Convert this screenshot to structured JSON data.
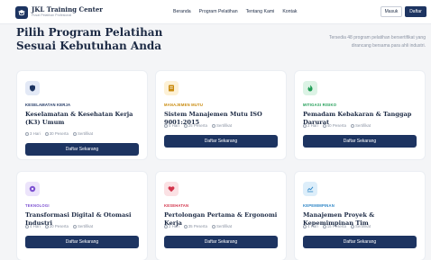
{
  "brand": {
    "title": "JKL Training Center",
    "subtitle": "Pusat Pelatihan Profesional"
  },
  "nav": {
    "links": [
      "Beranda",
      "Program Pelatihan",
      "Tentang Kami",
      "Kontak"
    ],
    "login": "Masuk",
    "register": "Daftar"
  },
  "hero": {
    "title_line1": "Pilih Program Pelatihan",
    "title_line2": "Sesuai Kebutuhan Anda",
    "desc_line1": "Tersedia 48 program pelatihan bersertifikat yang",
    "desc_line2": "dirancang bersama para ahli industri."
  },
  "colors": {
    "primary": "#1d3461",
    "background": "#f4f5f7"
  },
  "cards": [
    {
      "icon": "shield-icon",
      "category": "KESELAMATAN KERJA",
      "cat_color": "#1d3461",
      "icon_bg": "#e3e9f6",
      "title": "Keselamatan & Kesehatan Kerja (K3) Umum",
      "days": "3 Hari",
      "participants": "30 Peserta",
      "cert": "Sertifikat",
      "button": "Daftar Sekarang"
    },
    {
      "icon": "document-icon",
      "category": "MANAJEMEN MUTU",
      "cat_color": "#c98a0c",
      "icon_bg": "#fdf1d6",
      "title": "Sistem Manajemen Mutu ISO 9001:2015",
      "days": "5 Hari",
      "participants": "25 Peserta",
      "cert": "Sertifikat",
      "button": "Daftar Sekarang"
    },
    {
      "icon": "fire-icon",
      "category": "MITIGASI RISIKO",
      "cat_color": "#1f9d55",
      "icon_bg": "#dcf3e5",
      "title": "Pemadam Kebakaran & Tanggap Darurat",
      "days": "2 Hari",
      "participants": "40 Peserta",
      "cert": "Sertifikat",
      "button": "Daftar Sekarang"
    },
    {
      "icon": "gear-icon",
      "category": "TEKNOLOGI",
      "cat_color": "#7b4fd0",
      "icon_bg": "#ece4fb",
      "title": "Transformasi Digital & Otomasi Industri",
      "days": "4 Hari",
      "participants": "20 Peserta",
      "cert": "Sertifikat",
      "button": "Daftar Sekarang"
    },
    {
      "icon": "heart-icon",
      "category": "KESEHATAN",
      "cat_color": "#d2334a",
      "icon_bg": "#fbe1e4",
      "title": "Pertolongan Pertama & Ergonomi Kerja",
      "days": "2 Hari",
      "participants": "35 Peserta",
      "cert": "Sertifikat",
      "button": "Daftar Sekarang"
    },
    {
      "icon": "chart-icon",
      "category": "KEPEMIMPINAN",
      "cat_color": "#2a84c6",
      "icon_bg": "#ddeefa",
      "title": "Manajemen Proyek & Kepemimpinan Tim",
      "days": "4 Hari",
      "participants": "15 Peserta",
      "cert": "Sertifikat",
      "button": "Daftar Sekarang"
    }
  ]
}
